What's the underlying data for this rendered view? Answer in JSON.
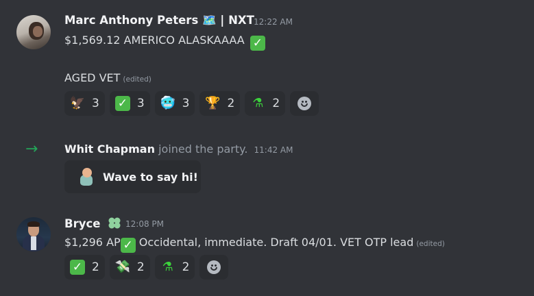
{
  "messages": [
    {
      "author": "Marc Anthony Peters 🗺️ | NXT",
      "timestamp": "12:22 AM",
      "line1": "$1,569.12 AMERICO ALASKAAAA",
      "line2": "AGED VET",
      "edited": "(edited)",
      "reactions": [
        {
          "emoji_name": "eagle-icon",
          "glyph": "🦅",
          "count": "3"
        },
        {
          "emoji_name": "check-mark-icon",
          "glyph": "✓",
          "count": "3"
        },
        {
          "emoji_name": "cold-face-icon",
          "glyph": "🥶",
          "count": "3"
        },
        {
          "emoji_name": "trophy-icon",
          "glyph": "🏆",
          "count": "2"
        },
        {
          "emoji_name": "flask-icon",
          "glyph": "⚗",
          "count": "2"
        }
      ]
    },
    {
      "system": true,
      "author": "Whit Chapman",
      "action": "joined the party.",
      "timestamp": "11:42 AM",
      "wave_label": "Wave to say hi!"
    },
    {
      "author": "Bryce",
      "timestamp": "12:08 PM",
      "line1_prefix": "$1,296 AP",
      "line1_suffix": "Occidental, immediate. Draft 04/01. VET OTP lead",
      "edited": "(edited)",
      "reactions": [
        {
          "emoji_name": "check-mark-icon",
          "glyph": "✓",
          "count": "2"
        },
        {
          "emoji_name": "money-wings-icon",
          "glyph": "💸",
          "count": "2"
        },
        {
          "emoji_name": "flask-icon",
          "glyph": "⚗",
          "count": "2"
        }
      ]
    }
  ],
  "colors": {
    "background": "#313338",
    "reaction_bg": "#2b2d31",
    "join_arrow": "#23a559",
    "check": "#4cb849"
  }
}
